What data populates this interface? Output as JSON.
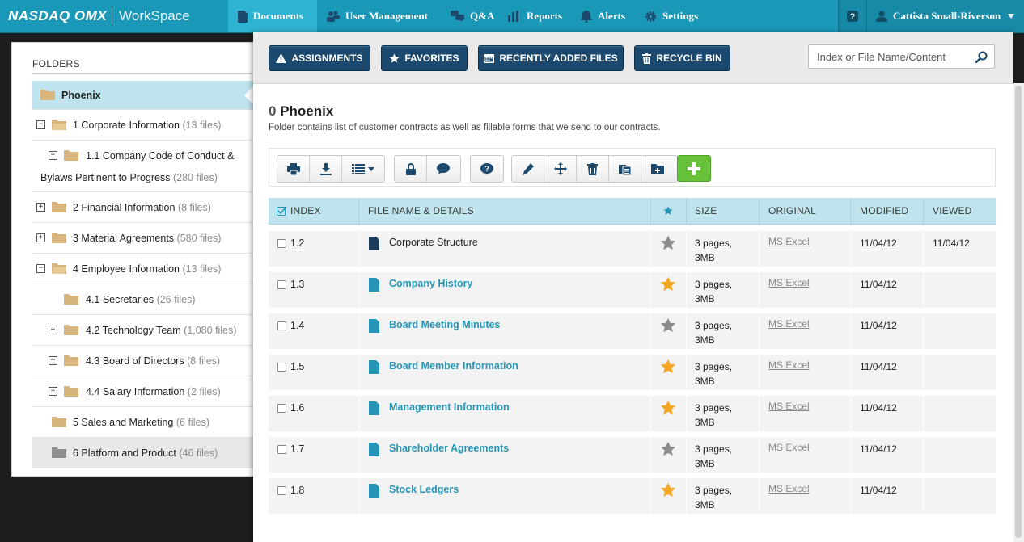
{
  "topnav": {
    "logo_brand": "NASDAQ OMX",
    "logo_product": "WorkSpace",
    "items": [
      {
        "label": "Documents",
        "icon": "document-icon",
        "active": true
      },
      {
        "label": "User Management",
        "icon": "users-icon"
      },
      {
        "label": "Q&A",
        "icon": "chat-icon"
      },
      {
        "label": "Reports",
        "icon": "bar-chart-icon"
      },
      {
        "label": "Alerts",
        "icon": "bell-icon"
      },
      {
        "label": "Settings",
        "icon": "gear-icon"
      }
    ],
    "help": "?",
    "user": "Cattista Small-Riverson"
  },
  "sidebar": {
    "title": "FOLDERS",
    "items": [
      {
        "label": "Phoenix",
        "count": "",
        "expander": "",
        "selected": true
      },
      {
        "label": "1 Corporate Information",
        "count": "(13 files)",
        "expander": "−"
      },
      {
        "label": "1.1 Company Code of Conduct &",
        "label2": "Bylaws Pertinent to Progress",
        "count": "(280 files)",
        "expander": "−"
      },
      {
        "label": "2 Financial Information",
        "count": "(8 files)",
        "expander": "+"
      },
      {
        "label": "3 Material Agreements",
        "count": "(580 files)",
        "expander": "+"
      },
      {
        "label": "4 Employee Information",
        "count": "(13 files)",
        "expander": "−"
      },
      {
        "label": "4.1 Secretaries",
        "count": "(26 files)",
        "expander": ""
      },
      {
        "label": "4.2 Technology Team",
        "count": "(1,080 files)",
        "expander": "+"
      },
      {
        "label": "4.3 Board of Directors",
        "count": "(8 files)",
        "expander": "+"
      },
      {
        "label": "4.4 Salary Information",
        "count": "(2 files)",
        "expander": "+"
      },
      {
        "label": "5 Sales and Marketing",
        "count": "(6 files)",
        "expander": ""
      },
      {
        "label": "6 Platform and Product",
        "count": "(46 files)",
        "expander": ""
      }
    ]
  },
  "toolbar": {
    "assignments": "ASSIGNMENTS",
    "favorites": "FAVORITES",
    "recent": "RECENTLY ADDED FILES",
    "recycle": "RECYCLE BIN",
    "search_placeholder": "Index or File Name/Content"
  },
  "folder": {
    "index": "0",
    "name": "Phoenix",
    "description": "Folder contains list of customer contracts as well as fillable forms that we send to our contracts."
  },
  "colors": {
    "nav": "#1a98b8",
    "button_dark": "#1c4a6e",
    "link": "#2796b6",
    "star_on": "#f5a623",
    "star_off": "#8c8c8c",
    "add_green": "#67c23a"
  },
  "table": {
    "headers": {
      "index": "INDEX",
      "name": "FILE NAME & DETAILS",
      "size": "SIZE",
      "original": "ORIGINAL",
      "modified": "MODIFIED",
      "viewed": "VIEWED"
    },
    "rows": [
      {
        "index": "1.2",
        "name": "Corporate Structure",
        "starred": false,
        "size1": "3 pages,",
        "size2": "3MB",
        "original": "MS Excel",
        "modified": "11/04/12",
        "viewed": "11/04/12",
        "viewed_style": "plain"
      },
      {
        "index": "1.3",
        "name": "Company History",
        "starred": true,
        "size1": "3 pages,",
        "size2": "3MB",
        "original": "MS Excel",
        "modified": "11/04/12",
        "viewed": ""
      },
      {
        "index": "1.4",
        "name": "Board Meeting Minutes",
        "starred": false,
        "size1": "3 pages,",
        "size2": "3MB",
        "original": "MS Excel",
        "modified": "11/04/12",
        "viewed": ""
      },
      {
        "index": "1.5",
        "name": "Board Member Information",
        "starred": true,
        "size1": "3 pages,",
        "size2": "3MB",
        "original": "MS Excel",
        "modified": "11/04/12",
        "viewed": ""
      },
      {
        "index": "1.6",
        "name": "Management Information",
        "starred": true,
        "size1": "3 pages,",
        "size2": "3MB",
        "original": "MS Excel",
        "modified": "11/04/12",
        "viewed": ""
      },
      {
        "index": "1.7",
        "name": "Shareholder Agreements",
        "starred": false,
        "size1": "3 pages,",
        "size2": "3MB",
        "original": "MS Excel",
        "modified": "11/04/12",
        "viewed": ""
      },
      {
        "index": "1.8",
        "name": "Stock Ledgers",
        "starred": true,
        "size1": "3 pages,",
        "size2": "3MB",
        "original": "MS Excel",
        "modified": "11/04/12",
        "viewed": ""
      }
    ]
  }
}
